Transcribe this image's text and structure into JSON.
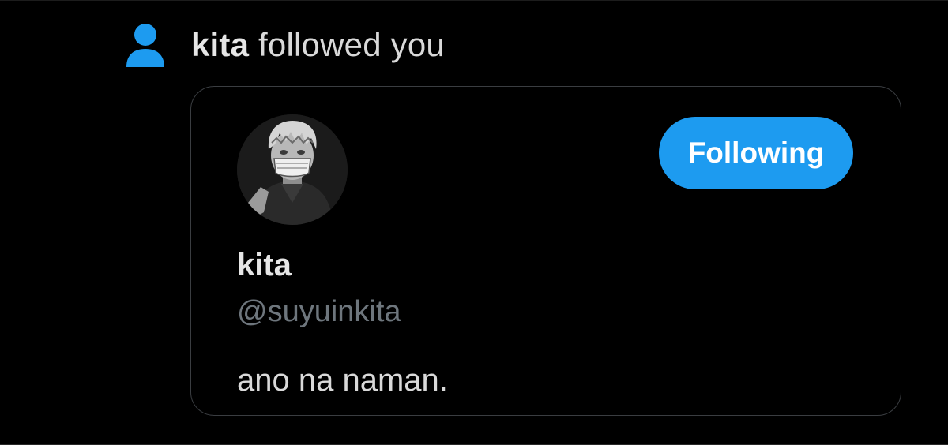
{
  "notification": {
    "icon": "person-icon",
    "actor_name": "kita",
    "action_text": " followed you"
  },
  "user_card": {
    "avatar": "avatar-image",
    "display_name": "kita",
    "handle": "@suyuinkita",
    "bio": "ano na naman.",
    "follow_button_label": "Following"
  },
  "colors": {
    "background": "#000000",
    "accent": "#1d9bf0",
    "primary_text": "#e6e6e6",
    "secondary_text": "#6e767d",
    "card_border": "#3a3d41"
  }
}
